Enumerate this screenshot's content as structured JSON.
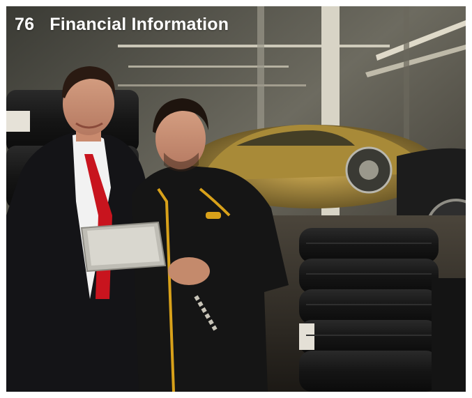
{
  "header": {
    "page_number": "76",
    "title": "Financial Information"
  },
  "photo": {
    "subject": "Two men in a tyre showroom looking at a tablet",
    "palette": {
      "background_dark": "#1a1611",
      "window_glow": "#6b6a5e",
      "car_gold": "#b7953f",
      "tie_red": "#c8141e",
      "uniform_black": "#151515",
      "uniform_accent": "#d8a11a"
    }
  }
}
